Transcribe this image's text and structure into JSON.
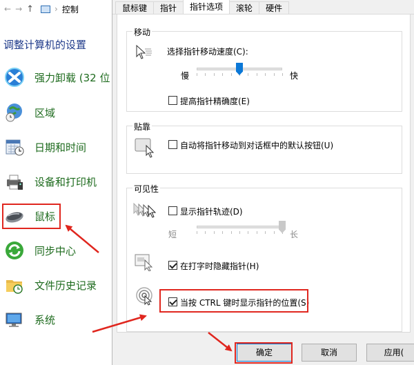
{
  "control_panel": {
    "nav": {
      "back": "←",
      "forward": "→",
      "up": "↑",
      "crumb": "控制",
      "sep": "›"
    },
    "title": "调整计算机的设置",
    "items": [
      {
        "label": "强力卸载 (32 位",
        "icon": "uninstall-icon"
      },
      {
        "label": "区域",
        "icon": "globe-clock-icon"
      },
      {
        "label": "日期和时间",
        "icon": "calendar-clock-icon"
      },
      {
        "label": "设备和打印机",
        "icon": "printer-icon"
      },
      {
        "label": "鼠标",
        "icon": "mouse-icon"
      },
      {
        "label": "同步中心",
        "icon": "sync-icon"
      },
      {
        "label": "文件历史记录",
        "icon": "folder-clock-icon"
      },
      {
        "label": "系统",
        "icon": "computer-icon"
      }
    ]
  },
  "dialog": {
    "tabs": [
      "鼠标键",
      "指针",
      "指针选项",
      "滚轮",
      "硬件"
    ],
    "active_tab": "指针选项",
    "motion": {
      "group_title": "移动",
      "speed_label": "选择指针移动速度(C):",
      "slow": "慢",
      "fast": "快",
      "speed_fraction": 0.5,
      "precision_label": "提高指针精确度(E)",
      "precision_checked": false
    },
    "snap": {
      "group_title": "贴靠",
      "snap_label": "自动将指针移动到对话框中的默认按钮(U)",
      "snap_checked": false
    },
    "visibility": {
      "group_title": "可见性",
      "trails_label": "显示指针轨迹(D)",
      "trails_checked": false,
      "short": "短",
      "long": "长",
      "trails_fraction": 1.0,
      "hide_label": "在打字时隐藏指针(H)",
      "hide_checked": true,
      "ctrl_label": "当按 CTRL 键时显示指针的位置(S)",
      "ctrl_checked": true
    },
    "buttons": {
      "ok": "确定",
      "cancel": "取消",
      "apply": "应用("
    },
    "colors": {
      "accent": "#0078d7",
      "annotation": "#e0261e",
      "cp_link": "#1e6b1e"
    }
  }
}
